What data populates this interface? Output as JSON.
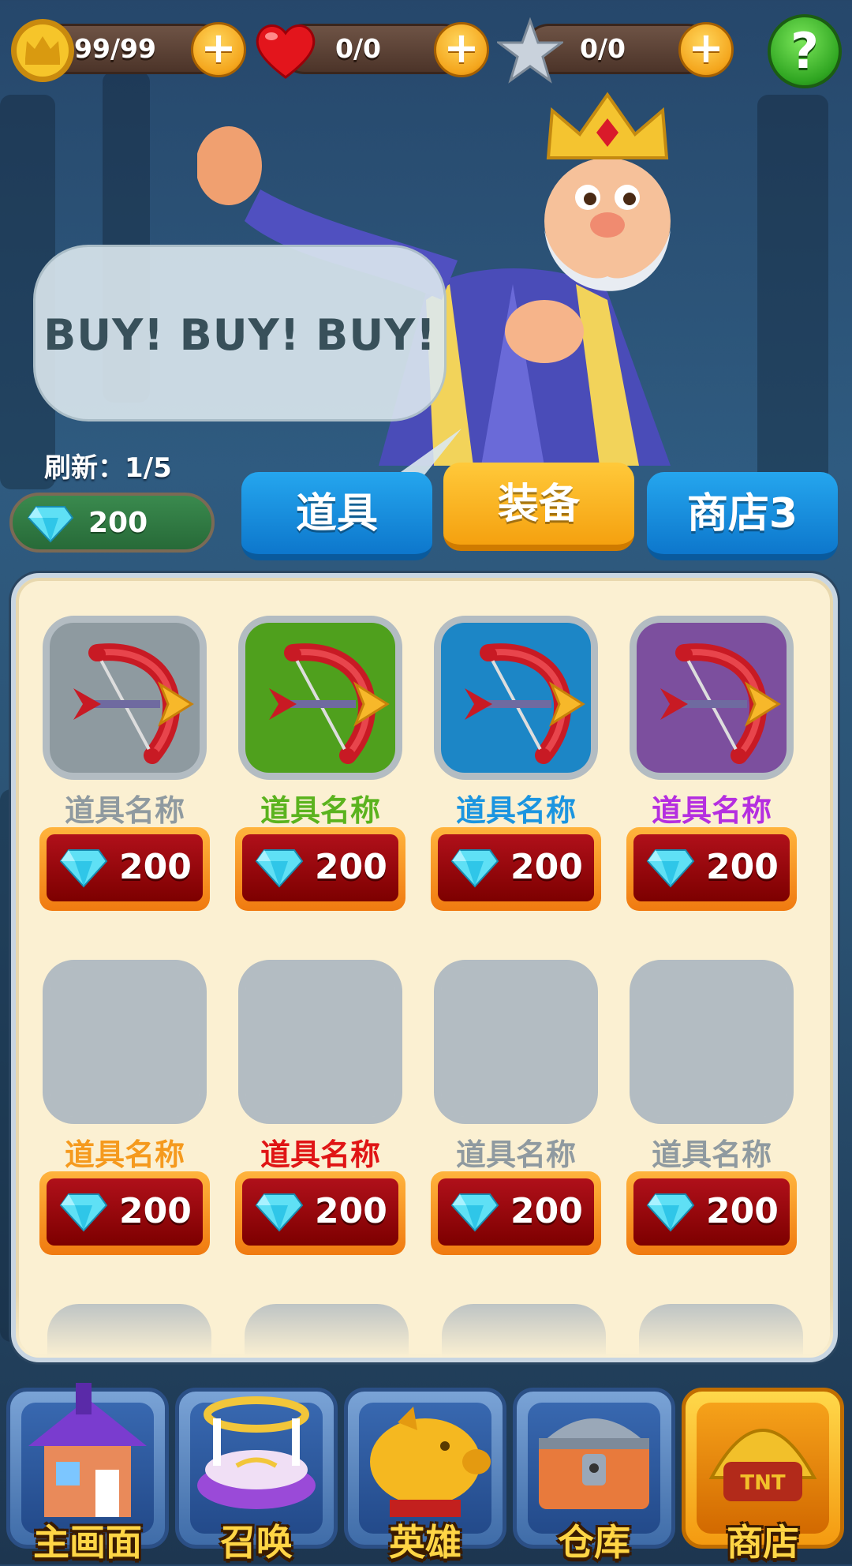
{
  "resources": [
    {
      "icon": "crown-icon",
      "value": "99/99"
    },
    {
      "icon": "heart-icon",
      "value": "0/0"
    },
    {
      "icon": "star-icon",
      "value": "0/0"
    }
  ],
  "help_label": "?",
  "speech_bubble": "BUY! BUY! BUY!",
  "refresh_label": "刷新：1/5",
  "gem_balance": "200",
  "tabs": [
    {
      "label": "道具",
      "active": false
    },
    {
      "label": "装备",
      "active": true
    },
    {
      "label": "商店3",
      "active": false
    }
  ],
  "items": [
    {
      "name": "道具名称",
      "name_color": "#8f9aa0",
      "frame_color": "#8e9aa0",
      "has_icon": true,
      "icon": "bow-icon",
      "price": "200"
    },
    {
      "name": "道具名称",
      "name_color": "#5bb31e",
      "frame_color": "#4fa01d",
      "has_icon": true,
      "icon": "bow-icon",
      "price": "200"
    },
    {
      "name": "道具名称",
      "name_color": "#1b95e0",
      "frame_color": "#1c86c6",
      "has_icon": true,
      "icon": "bow-icon",
      "price": "200"
    },
    {
      "name": "道具名称",
      "name_color": "#b52fe0",
      "frame_color": "#7c4f9e",
      "has_icon": true,
      "icon": "bow-icon",
      "price": "200"
    },
    {
      "name": "道具名称",
      "name_color": "#f59a1e",
      "frame_color": "#b3bcc2",
      "has_icon": false,
      "price": "200"
    },
    {
      "name": "道具名称",
      "name_color": "#e01515",
      "frame_color": "#b3bcc2",
      "has_icon": false,
      "price": "200"
    },
    {
      "name": "道具名称",
      "name_color": "#8f9aa0",
      "frame_color": "#b3bcc2",
      "has_icon": false,
      "price": "200"
    },
    {
      "name": "道具名称",
      "name_color": "#8f9aa0",
      "frame_color": "#b3bcc2",
      "has_icon": false,
      "price": "200"
    }
  ],
  "nav": [
    {
      "label": "主画面",
      "icon": "house-icon",
      "active": false
    },
    {
      "label": "召唤",
      "icon": "summon-altar-icon",
      "active": false
    },
    {
      "label": "英雄",
      "icon": "piggy-bank-icon",
      "active": false
    },
    {
      "label": "仓库",
      "icon": "treasure-chest-icon",
      "active": false
    },
    {
      "label": "商店",
      "icon": "tnt-shop-icon",
      "active": true
    }
  ]
}
